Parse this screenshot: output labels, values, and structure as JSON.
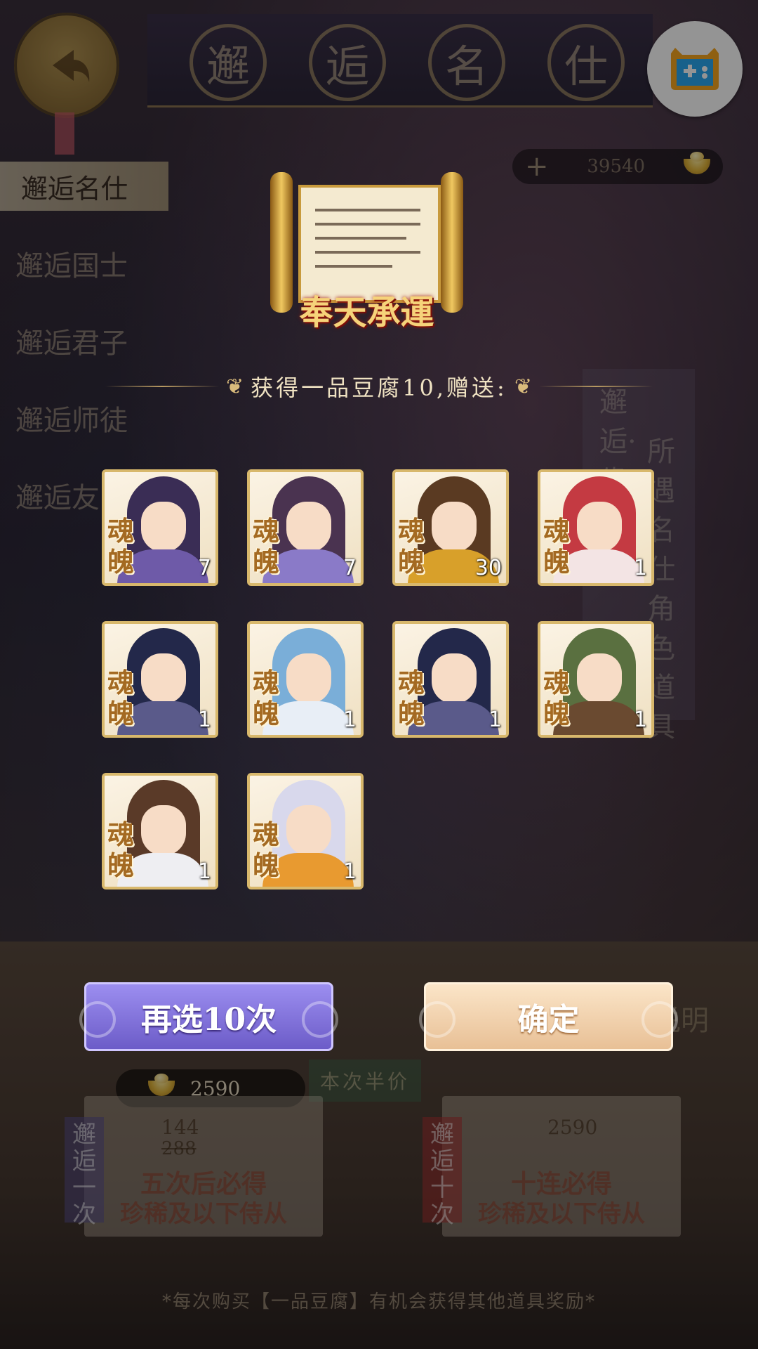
{
  "banner": {
    "title_chars": [
      "邂",
      "逅",
      "名",
      "仕"
    ]
  },
  "sidebar": {
    "active": "邂逅名仕",
    "items": [
      "邂逅国士",
      "邂逅君子",
      "邂逅师徒",
      "邂逅友"
    ]
  },
  "currency": {
    "plus": "+",
    "amount": "39540"
  },
  "side_panel": {
    "col1": "邂逅·缘",
    "col2": "所遇名仕角色道具"
  },
  "scroll_item": {
    "title": "奉天承運"
  },
  "reward_header": "获得一品豆腐10,赠送:",
  "rewards": [
    {
      "label": "魂魄",
      "count": "7",
      "hair": "#3a2d55",
      "robe": "#6e5aa8"
    },
    {
      "label": "魂魄",
      "count": "7",
      "hair": "#4a3350",
      "robe": "#8a7ac8"
    },
    {
      "label": "魂魄",
      "count": "30",
      "hair": "#5a3a22",
      "robe": "#d8a02a"
    },
    {
      "label": "魂魄",
      "count": "1",
      "hair": "#c43a42",
      "robe": "#f3e4e4"
    },
    {
      "label": "魂魄",
      "count": "1",
      "hair": "#23284a",
      "robe": "#5a5a8a"
    },
    {
      "label": "魂魄",
      "count": "1",
      "hair": "#7aaed8",
      "robe": "#e8eef6"
    },
    {
      "label": "魂魄",
      "count": "1",
      "hair": "#23284a",
      "robe": "#5a5a8a"
    },
    {
      "label": "魂魄",
      "count": "1",
      "hair": "#5a7040",
      "robe": "#6a4a30"
    },
    {
      "label": "魂魄",
      "count": "1",
      "hair": "#5a3a28",
      "robe": "#eeeef2"
    },
    {
      "label": "魂魄",
      "count": "1",
      "hair": "#d8d8ec",
      "robe": "#e89a30"
    }
  ],
  "buttons": {
    "again": "再选10次",
    "confirm": "确定"
  },
  "balance": {
    "amount": "2590"
  },
  "half_price_tag": "本次半价",
  "explain": "说明",
  "panel_one": {
    "label": "邂逅一次",
    "price": "144",
    "old_price": "288",
    "line1": "五次后必得",
    "line2": "珍稀及以下侍从"
  },
  "panel_ten": {
    "label": "邂逅十次",
    "price": "2590",
    "line1": "十连必得",
    "line2": "珍稀及以下侍从"
  },
  "footer": "*每次购买【一品豆腐】有机会获得其他道具奖励*",
  "icons": {
    "back": "back-arrow-icon",
    "gamepad": "gamepad-icon",
    "ingot": "gold-ingot-icon"
  }
}
